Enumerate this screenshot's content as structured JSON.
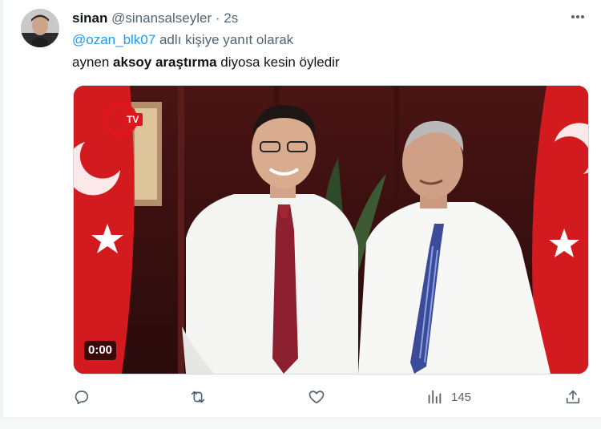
{
  "tweet": {
    "display_name": "sinan",
    "handle": "@sinansalseyler",
    "separator": "·",
    "time": "2s",
    "reply_prefix": "@ozan_blk07",
    "reply_suffix": " adlı kişiye yanıt olarak",
    "text_before": "aynen ",
    "text_bold": "aksoy araştırma",
    "text_after": " diyosa kesin öyledir"
  },
  "media": {
    "duration": "0:00",
    "channel_logo_text": "TV"
  },
  "actions": {
    "reply_icon": "reply-icon",
    "retweet_icon": "retweet-icon",
    "like_icon": "like-icon",
    "views_icon": "views-icon",
    "views_count": "145",
    "share_icon": "share-icon"
  },
  "colors": {
    "accent": "#1d9bf0",
    "secondary_text": "#536471",
    "flag_red": "#d21a1f"
  }
}
